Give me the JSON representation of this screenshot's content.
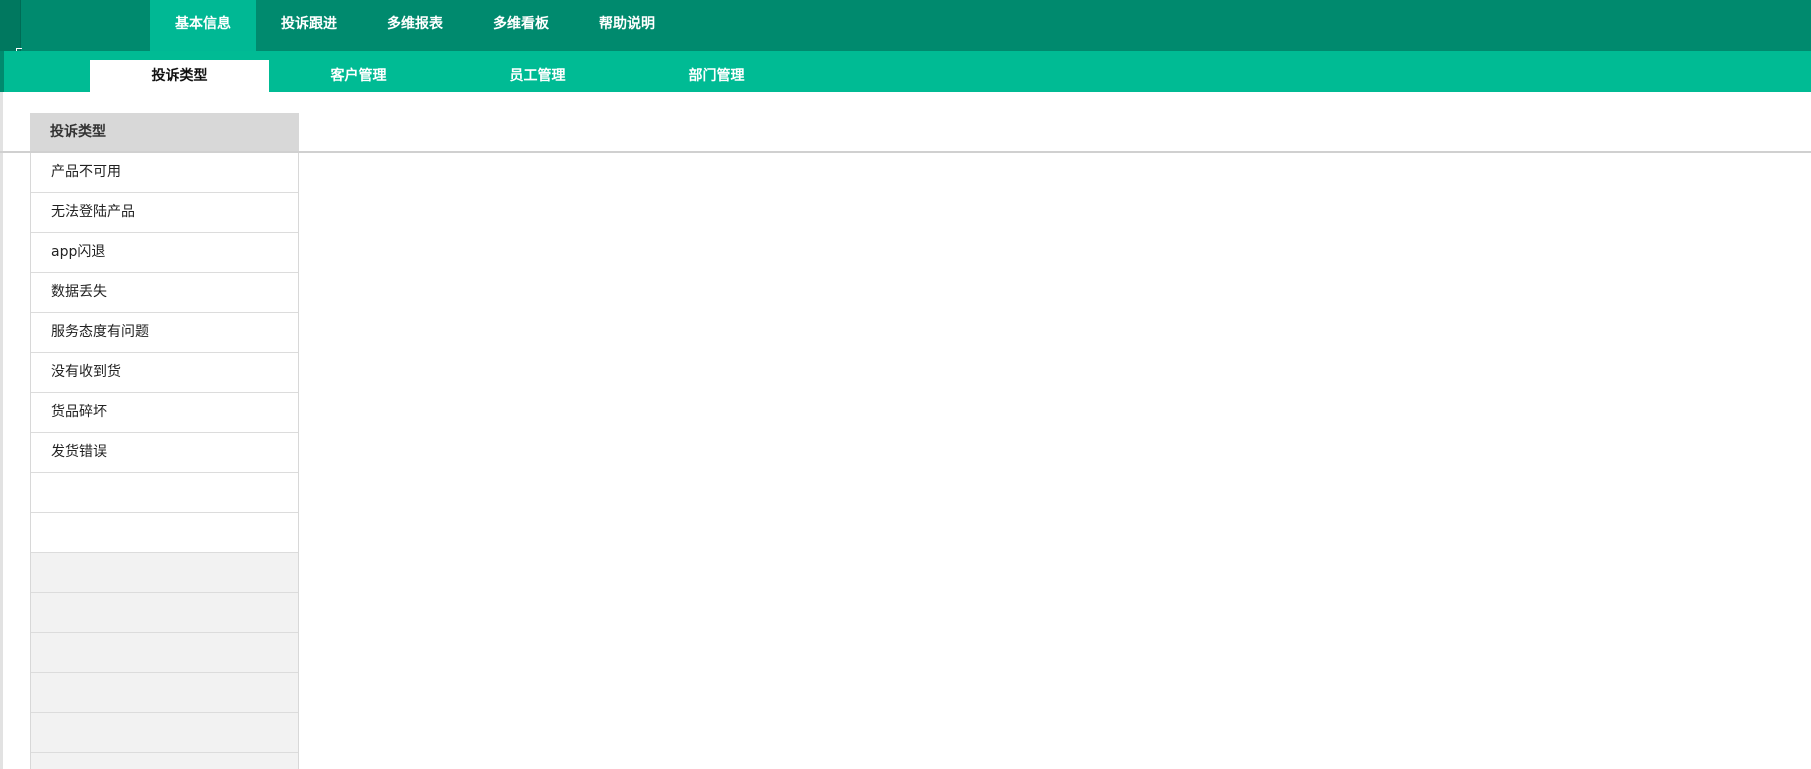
{
  "topnav": {
    "items": [
      {
        "label": "基本信息",
        "active": true
      },
      {
        "label": "投诉跟进",
        "active": false
      },
      {
        "label": "多维报表",
        "active": false
      },
      {
        "label": "多维看板",
        "active": false
      },
      {
        "label": "帮助说明",
        "active": false
      }
    ]
  },
  "subnav": {
    "items": [
      {
        "label": "投诉类型",
        "active": true
      },
      {
        "label": "客户管理",
        "active": false
      },
      {
        "label": "员工管理",
        "active": false
      },
      {
        "label": "部门管理",
        "active": false
      }
    ]
  },
  "complaint_types": {
    "header": "投诉类型",
    "rows": [
      "产品不可用",
      "无法登陆产品",
      "app闪退",
      "数据丢失",
      "服务态度有问题",
      "没有收到货",
      "货品碎坏",
      "发货错误"
    ]
  },
  "colors": {
    "topbar": "#008a6e",
    "topnav_active": "#00b894",
    "subbar": "#00bb94",
    "list_header": "#d8d8d8",
    "filler_row": "#f2f2f2"
  }
}
